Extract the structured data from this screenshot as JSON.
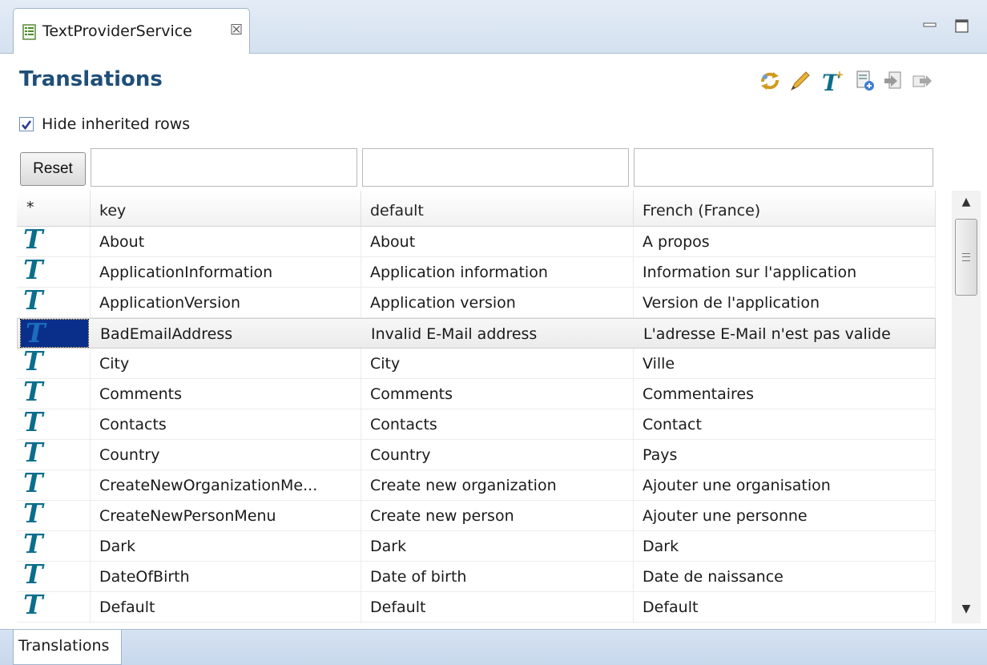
{
  "editor_tab": {
    "title": "TextProviderService",
    "close_glyph": "☒"
  },
  "window_controls": {
    "minimize": "minimize-icon",
    "maximize": "maximize-icon"
  },
  "page": {
    "title": "Translations"
  },
  "toolbar": {
    "icons": [
      "sync-icon",
      "edit-icon",
      "add-text-icon",
      "new-file-icon",
      "import-icon",
      "export-icon"
    ]
  },
  "options": {
    "hide_inherited_label": "Hide inherited rows",
    "hide_inherited_checked": true
  },
  "filters": {
    "reset_label": "Reset",
    "key_filter": "",
    "default_filter": "",
    "french_filter": ""
  },
  "table": {
    "columns": [
      "*",
      "key",
      "default",
      "French (France)"
    ],
    "row_icon_glyph": "T",
    "selected_row_index": 3,
    "rows": [
      {
        "key": "About",
        "default": "About",
        "french": "A propos"
      },
      {
        "key": "ApplicationInformation",
        "default": "Application information",
        "french": "Information sur l'application"
      },
      {
        "key": "ApplicationVersion",
        "default": "Application version",
        "french": "Version de l'application"
      },
      {
        "key": "BadEmailAddress",
        "default": "Invalid E-Mail address",
        "french": "L'adresse E-Mail n'est pas valide"
      },
      {
        "key": "City",
        "default": "City",
        "french": "Ville"
      },
      {
        "key": "Comments",
        "default": "Comments",
        "french": "Commentaires"
      },
      {
        "key": "Contacts",
        "default": "Contacts",
        "french": "Contact"
      },
      {
        "key": "Country",
        "default": "Country",
        "french": "Pays"
      },
      {
        "key": "CreateNewOrganizationMe...",
        "default": "Create new organization",
        "french": "Ajouter une organisation"
      },
      {
        "key": "CreateNewPersonMenu",
        "default": "Create new person",
        "french": "Ajouter une personne"
      },
      {
        "key": "Dark",
        "default": "Dark",
        "french": "Dark"
      },
      {
        "key": "DateOfBirth",
        "default": "Date of birth",
        "french": "Date de naissance"
      },
      {
        "key": "Default",
        "default": "Default",
        "french": "Default"
      }
    ]
  },
  "bottom_tabs": [
    "Translations"
  ],
  "colors": {
    "title": "#1f4e79",
    "text_icon": "#0b6e8c",
    "selection": "#0a2f8a",
    "tab_strip": "#d4e1f0"
  }
}
